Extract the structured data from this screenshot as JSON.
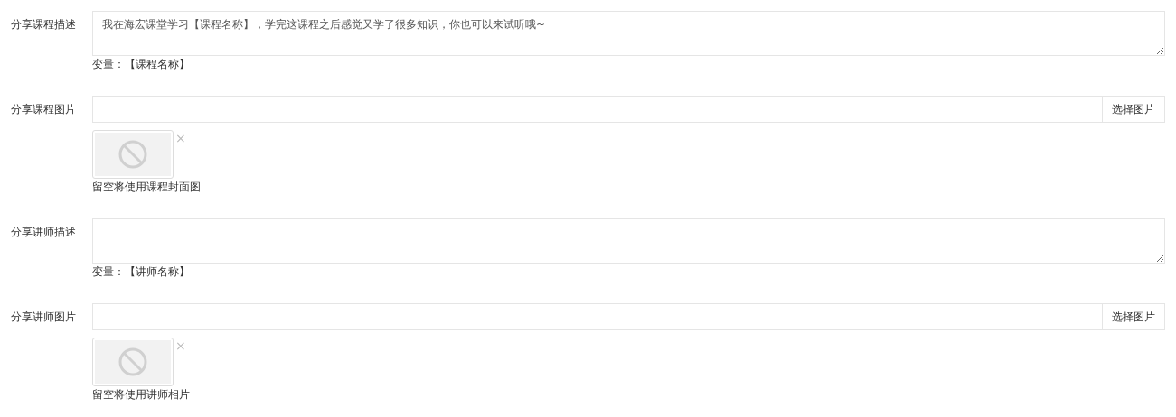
{
  "fields": [
    {
      "kind": "textarea",
      "label": "分享课程描述",
      "value": "我在海宏课堂学习【课程名称】，学完这课程之后感觉又学了很多知识，你也可以来试听哦~",
      "hint": "变量：【课程名称】"
    },
    {
      "kind": "image",
      "label": "分享课程图片",
      "button": "选择图片",
      "remove": "×",
      "hint": "留空将使用课程封面图"
    },
    {
      "kind": "textarea",
      "label": "分享讲师描述",
      "hint": "变量：【讲师名称】"
    },
    {
      "kind": "image",
      "label": "分享讲师图片",
      "button": "选择图片",
      "remove": "×",
      "hint": "留空将使用讲师相片"
    }
  ]
}
